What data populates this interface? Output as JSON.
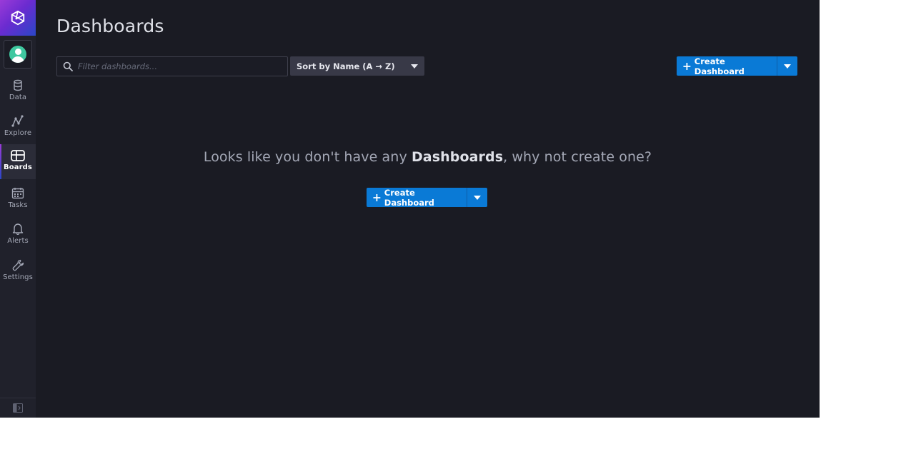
{
  "sidebar": {
    "logo_name": "influxdb-logo",
    "avatar_icon": "user-avatar",
    "items": [
      {
        "label": "Data",
        "icon": "database-icon"
      },
      {
        "label": "Explore",
        "icon": "graph-line-icon"
      },
      {
        "label": "Boards",
        "icon": "dashboard-grid-icon",
        "active": true
      },
      {
        "label": "Tasks",
        "icon": "calendar-icon"
      },
      {
        "label": "Alerts",
        "icon": "bell-icon"
      },
      {
        "label": "Settings",
        "icon": "wrench-icon"
      }
    ],
    "collapse_icon": "collapse-sidebar-icon"
  },
  "page": {
    "title": "Dashboards"
  },
  "toolbar": {
    "search_placeholder": "Filter dashboards...",
    "sort_label": "Sort by Name (A → Z)",
    "create_label": "Create Dashboard"
  },
  "empty_state": {
    "prefix": "Looks like you don't have any ",
    "emphasis": "Dashboards",
    "suffix": ", why not create one?",
    "create_label": "Create Dashboard"
  },
  "colors": {
    "background": "#1a1b23",
    "sidebar": "#20212b",
    "primary_button": "#0a7ad6",
    "sort_dropdown": "#383947",
    "accent_gradient_start": "#9a3bd8",
    "accent_gradient_end": "#2a47c8"
  }
}
